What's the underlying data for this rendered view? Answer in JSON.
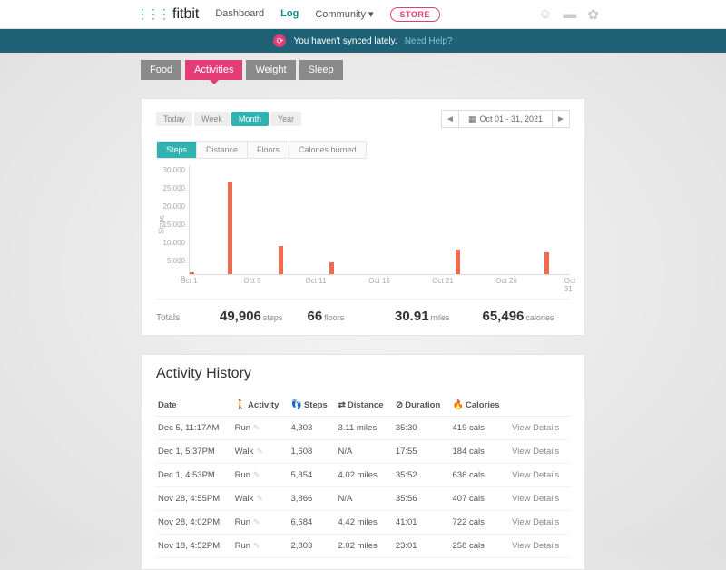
{
  "brand": "fitbit",
  "nav": {
    "items": [
      "Dashboard",
      "Log",
      "Community"
    ],
    "active": "Log",
    "store": "STORE"
  },
  "sync_banner": {
    "text": "You haven't synced lately.",
    "link": "Need Help?"
  },
  "log_tabs": {
    "items": [
      "Food",
      "Activities",
      "Weight",
      "Sleep"
    ],
    "active": "Activities"
  },
  "range": {
    "items": [
      "Today",
      "Week",
      "Month",
      "Year"
    ],
    "active": "Month",
    "display": "Oct 01 - 31, 2021"
  },
  "metric_tabs": {
    "items": [
      "Steps",
      "Distance",
      "Floors",
      "Calories burned"
    ],
    "active": "Steps"
  },
  "chart_data": {
    "type": "bar",
    "ylabel": "Steps",
    "ylim": [
      0,
      30000
    ],
    "y_ticks": [
      0,
      5000,
      10000,
      15000,
      20000,
      25000,
      30000
    ],
    "y_tick_labels": [
      "0",
      "5,000",
      "10,000",
      "15,000",
      "20,000",
      "25,000",
      "30,000"
    ],
    "x_tick_labels": [
      "Oct 1",
      "Oct 6",
      "Oct 11",
      "Oct 16",
      "Oct 21",
      "Oct 26",
      "Oct 31"
    ],
    "x_tick_days": [
      1,
      6,
      11,
      16,
      21,
      26,
      31
    ],
    "days_in_month": 31,
    "bars": [
      {
        "day": 1,
        "value": 600
      },
      {
        "day": 4,
        "value": 25500
      },
      {
        "day": 8,
        "value": 7800
      },
      {
        "day": 12,
        "value": 3200
      },
      {
        "day": 22,
        "value": 6700
      },
      {
        "day": 29,
        "value": 6100
      }
    ]
  },
  "totals": {
    "label": "Totals",
    "items": [
      {
        "value": "49,906",
        "unit": "steps"
      },
      {
        "value": "66",
        "unit": "floors"
      },
      {
        "value": "30.91",
        "unit": "miles"
      },
      {
        "value": "65,496",
        "unit": "calories"
      }
    ]
  },
  "history": {
    "title": "Activity History",
    "view_label": "View Details",
    "columns": {
      "date": "Date",
      "activity": "Activity",
      "steps": "Steps",
      "distance": "Distance",
      "duration": "Duration",
      "calories": "Calories"
    },
    "icons": {
      "activity": "🚶",
      "steps": "👣",
      "distance": "⇄",
      "duration": "⊘",
      "calories": "🔥"
    },
    "rows": [
      {
        "date": "Dec 5, 11:17AM",
        "activity": "Run",
        "steps": "4,303",
        "distance": "3.11 miles",
        "duration": "35:30",
        "calories": "419 cals"
      },
      {
        "date": "Dec 1, 5:37PM",
        "activity": "Walk",
        "steps": "1,608",
        "distance": "N/A",
        "duration": "17:55",
        "calories": "184 cals"
      },
      {
        "date": "Dec 1, 4:53PM",
        "activity": "Run",
        "steps": "5,854",
        "distance": "4.02 miles",
        "duration": "35:52",
        "calories": "636 cals"
      },
      {
        "date": "Nov 28, 4:55PM",
        "activity": "Walk",
        "steps": "3,866",
        "distance": "N/A",
        "duration": "35:56",
        "calories": "407 cals"
      },
      {
        "date": "Nov 28, 4:02PM",
        "activity": "Run",
        "steps": "6,684",
        "distance": "4.42 miles",
        "duration": "41:01",
        "calories": "722 cals"
      },
      {
        "date": "Nov 18, 4:52PM",
        "activity": "Run",
        "steps": "2,803",
        "distance": "2.02 miles",
        "duration": "23:01",
        "calories": "258 cals"
      }
    ]
  }
}
